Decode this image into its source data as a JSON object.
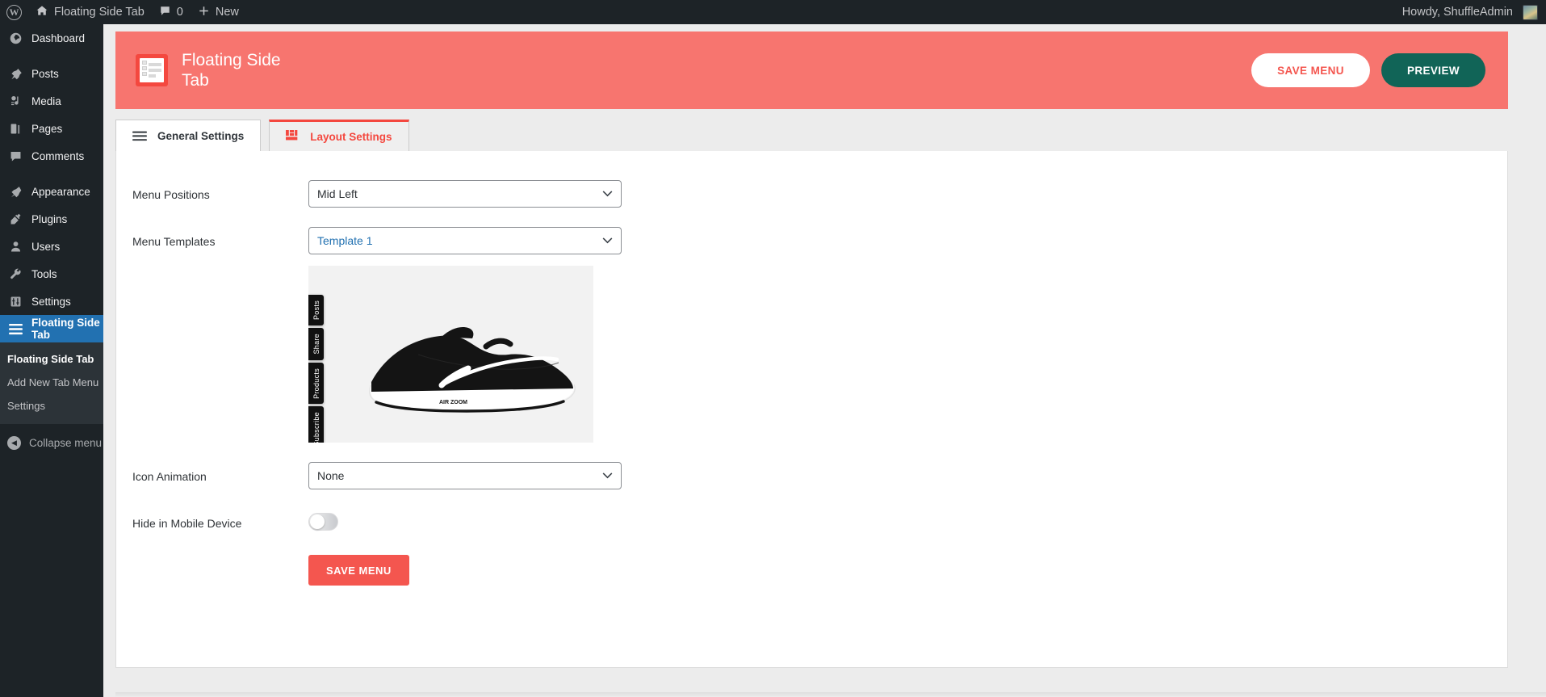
{
  "adminbar": {
    "logo_icon": "wordpress-icon",
    "site_icon": "home-icon",
    "site_name": "Floating Side Tab",
    "comments_icon": "comment-bubble-icon",
    "comments_count": "0",
    "new_icon": "plus-icon",
    "new_label": "New",
    "howdy": "Howdy, ShuffleAdmin"
  },
  "sidebar": {
    "items": [
      {
        "label": "Dashboard",
        "icon": "dashboard-icon"
      },
      {
        "label": "Posts",
        "icon": "pin-icon"
      },
      {
        "label": "Media",
        "icon": "media-icon"
      },
      {
        "label": "Pages",
        "icon": "pages-icon"
      },
      {
        "label": "Comments",
        "icon": "comment-bubble-icon"
      },
      {
        "label": "Appearance",
        "icon": "appearance-brush-icon"
      },
      {
        "label": "Plugins",
        "icon": "plugin-icon"
      },
      {
        "label": "Users",
        "icon": "user-icon"
      },
      {
        "label": "Tools",
        "icon": "wrench-icon"
      },
      {
        "label": "Settings",
        "icon": "sliders-icon"
      },
      {
        "label": "Floating Side Tab",
        "icon": "hamburger-icon"
      }
    ],
    "submenu": [
      {
        "label": "Floating Side Tab"
      },
      {
        "label": "Add New Tab Menu"
      },
      {
        "label": "Settings"
      }
    ],
    "collapse": {
      "label": "Collapse menu",
      "icon": "arrow-left-circle-icon"
    }
  },
  "banner": {
    "logo_icon": "floating-side-tab-logo-icon",
    "title": "Floating Side Tab",
    "save_label": "SAVE MENU",
    "preview_label": "PREVIEW",
    "bg_color": "#F7756F",
    "preview_color": "#116457",
    "save_text_color": "#F4564F"
  },
  "tabs": [
    {
      "label": "General Settings",
      "icon": "hamburger-icon",
      "active": false
    },
    {
      "label": "Layout Settings",
      "icon": "layout-grid-icon",
      "active": true
    }
  ],
  "form": {
    "menu_positions": {
      "label": "Menu Positions",
      "value": "Mid Left"
    },
    "menu_templates": {
      "label": "Menu Templates",
      "value": "Template 1"
    },
    "icon_animation": {
      "label": "Icon Animation",
      "value": "None"
    },
    "hide_mobile": {
      "label": "Hide in Mobile Device",
      "value": "off"
    },
    "save_label": "SAVE MENU",
    "accent_color": "#F4564F"
  },
  "preview": {
    "image_alt": "black-nike-running-shoe",
    "tabs": [
      "Posts",
      "Share",
      "Products",
      "Subscribe"
    ]
  }
}
